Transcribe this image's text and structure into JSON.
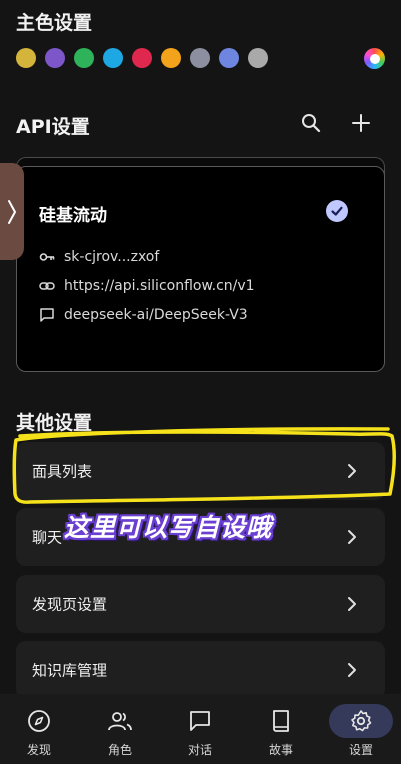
{
  "theme": {
    "title": "主色设置",
    "swatches": [
      "#d4b43a",
      "#7d57c9",
      "#2fb35a",
      "#1da7e3",
      "#e0284e",
      "#f2a21b",
      "#8c8fa0",
      "#6f86e0",
      "#a9a9a9"
    ]
  },
  "api": {
    "title": "API设置",
    "card": {
      "name": "硅基流动",
      "key": "sk-cjrov...zxof",
      "url": "https://api.siliconflow.cn/v1",
      "model": "deepseek-ai/DeepSeek-V3"
    }
  },
  "other": {
    "title": "其他设置",
    "items": [
      {
        "label": "面具列表"
      },
      {
        "label": "聊天"
      },
      {
        "label": "发现页设置"
      },
      {
        "label": "知识库管理"
      }
    ]
  },
  "annotation": {
    "caption": "这里可以写自设哦",
    "color": "#f5e21a"
  },
  "nav": {
    "items": [
      {
        "label": "发现",
        "icon": "compass-icon"
      },
      {
        "label": "角色",
        "icon": "people-icon"
      },
      {
        "label": "对话",
        "icon": "chat-icon"
      },
      {
        "label": "故事",
        "icon": "book-icon"
      },
      {
        "label": "设置",
        "icon": "gear-icon",
        "active": true
      }
    ]
  }
}
